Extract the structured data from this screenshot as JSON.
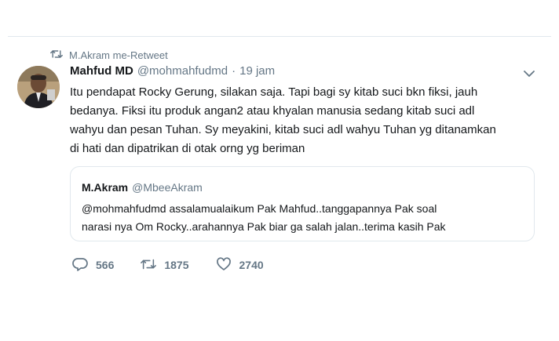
{
  "retweet_context": {
    "label": "M.Akram me-Retweet"
  },
  "tweet": {
    "name": "Mahfud MD",
    "handle": "@mohmahfudmd",
    "separator": "·",
    "time": "19 jam",
    "text_lines": [
      "Itu pendapat Rocky Gerung, silakan saja. Tapi bagi sy kitab suci bkn fiksi, jauh",
      "bedanya. Fiksi itu produk angan2 atau khyalan manusia sedang kitab suci adl",
      "wahyu dan pesan Tuhan. Sy meyakini, kitab suci adl wahyu Tuhan yg ditanamkan",
      "di hati dan dipatrikan di otak orng yg beriman"
    ]
  },
  "quote": {
    "name": "M.Akram",
    "handle": "@MbeeAkram",
    "text_lines": [
      "@mohmahfudmd assalamualaikum Pak Mahfud..tanggapannya Pak soal",
      "narasi nya Om Rocky..arahannya Pak biar ga salah jalan..terima kasih Pak"
    ]
  },
  "actions": {
    "reply_count": "566",
    "retweet_count": "1875",
    "like_count": "2740"
  },
  "icons": {
    "retweet_context": "retweet-icon",
    "caret": "chevron-down-icon",
    "reply": "reply-icon",
    "retweet": "retweet-icon",
    "like": "heart-icon"
  },
  "colors": {
    "text": "#14171a",
    "muted": "#657786",
    "border": "#e1e8ed"
  }
}
